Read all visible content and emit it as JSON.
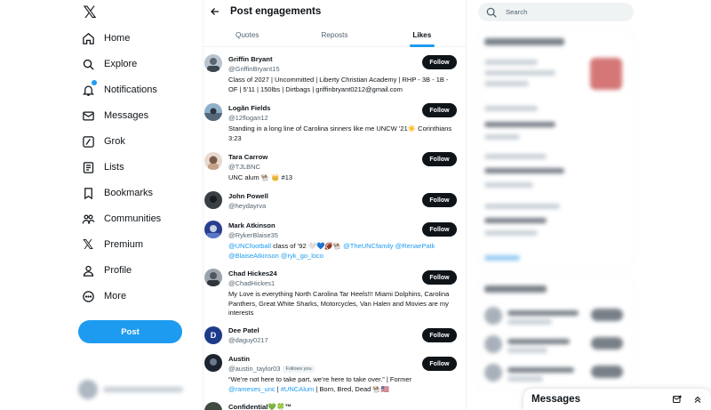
{
  "nav": {
    "items": [
      {
        "label": "Home",
        "icon": "home-icon"
      },
      {
        "label": "Explore",
        "icon": "search-icon"
      },
      {
        "label": "Notifications",
        "icon": "bell-icon"
      },
      {
        "label": "Messages",
        "icon": "envelope-icon"
      },
      {
        "label": "Grok",
        "icon": "grok-icon"
      },
      {
        "label": "Lists",
        "icon": "list-icon"
      },
      {
        "label": "Bookmarks",
        "icon": "bookmark-icon"
      },
      {
        "label": "Communities",
        "icon": "people-icon"
      },
      {
        "label": "Premium",
        "icon": "x-logo-icon"
      },
      {
        "label": "Profile",
        "icon": "person-icon"
      },
      {
        "label": "More",
        "icon": "more-circle-icon"
      }
    ],
    "post_label": "Post"
  },
  "header": {
    "title": "Post engagements"
  },
  "tabs": [
    {
      "label": "Quotes",
      "active": false
    },
    {
      "label": "Reposts",
      "active": false
    },
    {
      "label": "Likes",
      "active": true
    }
  ],
  "follow_label": "Follow",
  "follows_you_label": "Follows you",
  "users": [
    {
      "name": "Griffin Bryant",
      "handle": "@GriffinBryant15",
      "bio": "Class of 2027 | Uncommitted | Liberty Christian Academy | RHP - 3B - 1B - OF | 5'11 | 150lbs | Dirtbags | griffinbryant0212@gmail.com"
    },
    {
      "name": "Logãn Fields",
      "handle": "@12flogan12",
      "bio": "Standing in a long line of Carolina sinners like me UNCW ’21☀️ Corinthians 3:23"
    },
    {
      "name": "Tara Carrow",
      "handle": "@TJLBNC",
      "bio": "UNC alum 🐏 👑 #13"
    },
    {
      "name": "John Powell",
      "handle": "@heydayrva",
      "bio": ""
    },
    {
      "name": "Mark Atkinson",
      "handle": "@RykerBlaise35",
      "bio_parts": [
        {
          "text": "@UNCfootball",
          "link": true
        },
        {
          "text": " class of ’92 🤍💙🏈🐏 ",
          "link": false
        },
        {
          "text": "@TheUNCfamily",
          "link": true
        },
        {
          "text": " ",
          "link": false
        },
        {
          "text": "@RenaePatk",
          "link": true
        },
        {
          "text": " ",
          "link": false
        },
        {
          "text": "@BlaiseAtkinson",
          "link": true
        },
        {
          "text": " ",
          "link": false
        },
        {
          "text": "@ryk_go_loco",
          "link": true
        }
      ]
    },
    {
      "name": "Chad Hickes24",
      "handle": "@ChadHickes1",
      "bio": "My Love is everything North Carolina Tar Heels!!! Miami Dolphins, Carolina Panthers, Great White Sharks, Motorcycles, Van Halen and Movies are my interests"
    },
    {
      "name": "Dee Patel",
      "handle": "@daguy0217",
      "avatar_letter": "D",
      "bio": ""
    },
    {
      "name": "Austin",
      "handle": "@austin_taylor03",
      "follows_you": true,
      "bio_parts": [
        {
          "text": "“We’re not here to take part, we’re here to take over.” | Former ",
          "link": false
        },
        {
          "text": "@rameses_unc",
          "link": true
        },
        {
          "text": " | ",
          "link": false
        },
        {
          "text": "#UNCAlum",
          "link": true
        },
        {
          "text": " | Born, Bred, Dead 🐏🇺🇸",
          "link": false
        }
      ]
    },
    {
      "name": "Confidential💚🍀™",
      "handle": "",
      "bio": ""
    }
  ],
  "search": {
    "placeholder": "Search"
  },
  "messages_drawer": {
    "title": "Messages"
  },
  "colors": {
    "accent": "#1d9bf0",
    "text": "#0f1419",
    "muted": "#536471",
    "follow_bg": "#0f1419"
  }
}
